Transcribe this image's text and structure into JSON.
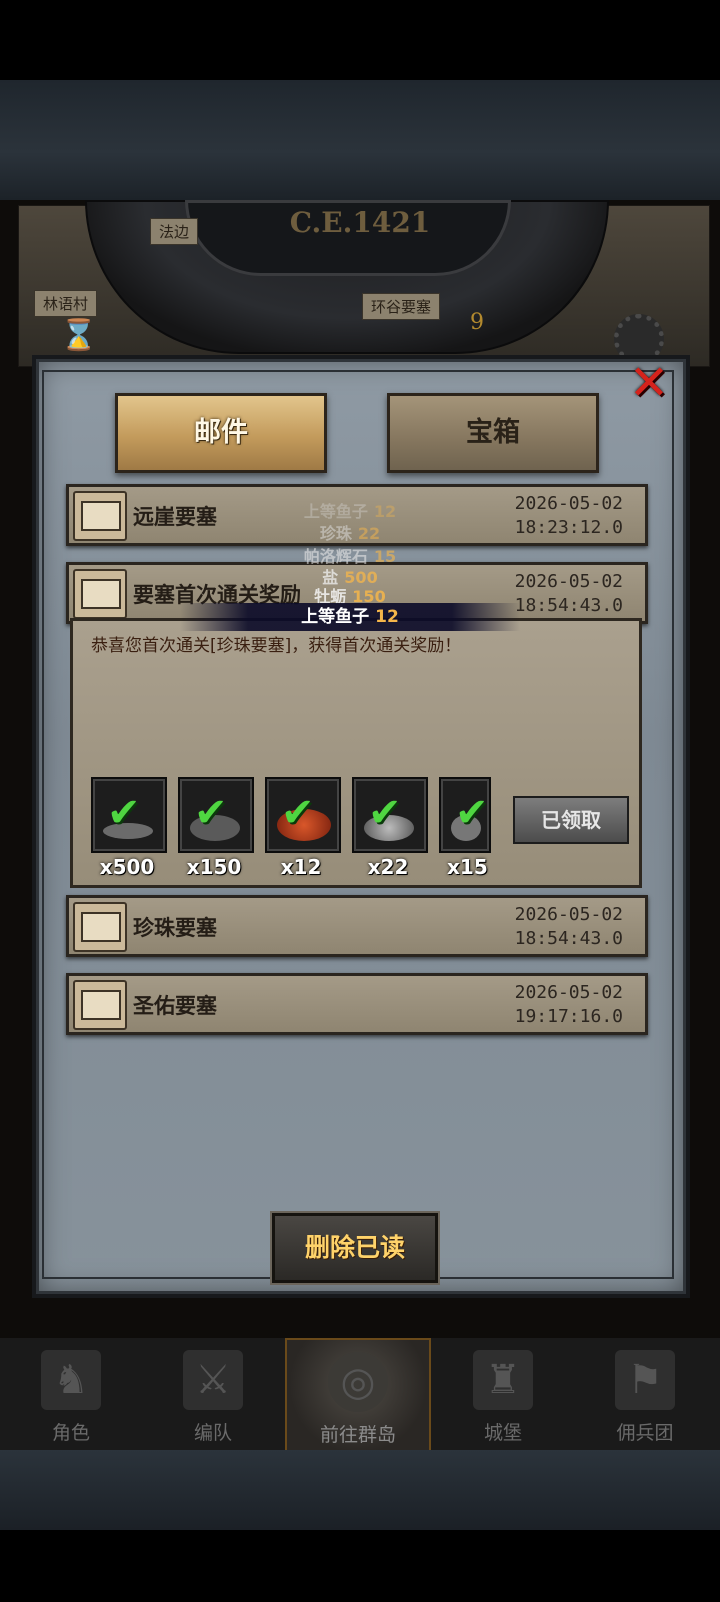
{
  "map": {
    "year": "C.E.1421",
    "labels": [
      "法边",
      "林语村",
      "环谷要塞"
    ],
    "dial_number": "9"
  },
  "tabs": {
    "mail": "邮件",
    "chest": "宝箱"
  },
  "mails": [
    {
      "title": "远崖要塞",
      "date": "2026-05-02",
      "time": "18:23:12.0"
    },
    {
      "title": "要塞首次通关奖励",
      "date": "2026-05-02",
      "time": "18:54:43.0"
    },
    {
      "title": "珍珠要塞",
      "date": "2026-05-02",
      "time": "18:54:43.0"
    },
    {
      "title": "圣佑要塞",
      "date": "2026-05-02",
      "time": "19:17:16.0"
    }
  ],
  "expanded": {
    "message": "恭喜您首次通关[珍珠要塞]，获得首次通关奖励！",
    "rewards": [
      {
        "icon": "salt-icon",
        "qty": "x500"
      },
      {
        "icon": "oyster-icon",
        "qty": "x150"
      },
      {
        "icon": "fish-roe-icon",
        "qty": "x12"
      },
      {
        "icon": "pearl-icon",
        "qty": "x22"
      },
      {
        "icon": "palo-stone-icon",
        "qty": "x15"
      }
    ],
    "claimed_label": "已领取"
  },
  "popup": [
    {
      "name": "上等鱼子",
      "value": "12"
    },
    {
      "name": "珍珠",
      "value": "22"
    },
    {
      "name": "帕洛辉石",
      "value": "15"
    },
    {
      "name": "盐",
      "value": "500"
    },
    {
      "name": "牡蛎",
      "value": "150"
    },
    {
      "name": "上等鱼子",
      "value": "12"
    }
  ],
  "delete_button": "删除已读",
  "nav": [
    {
      "label": "角色",
      "icon": "knight-icon"
    },
    {
      "label": "编队",
      "icon": "squad-icon"
    },
    {
      "label": "前往群岛",
      "icon": "globe-icon"
    },
    {
      "label": "城堡",
      "icon": "castle-icon"
    },
    {
      "label": "佣兵团",
      "icon": "mercenary-icon"
    }
  ]
}
